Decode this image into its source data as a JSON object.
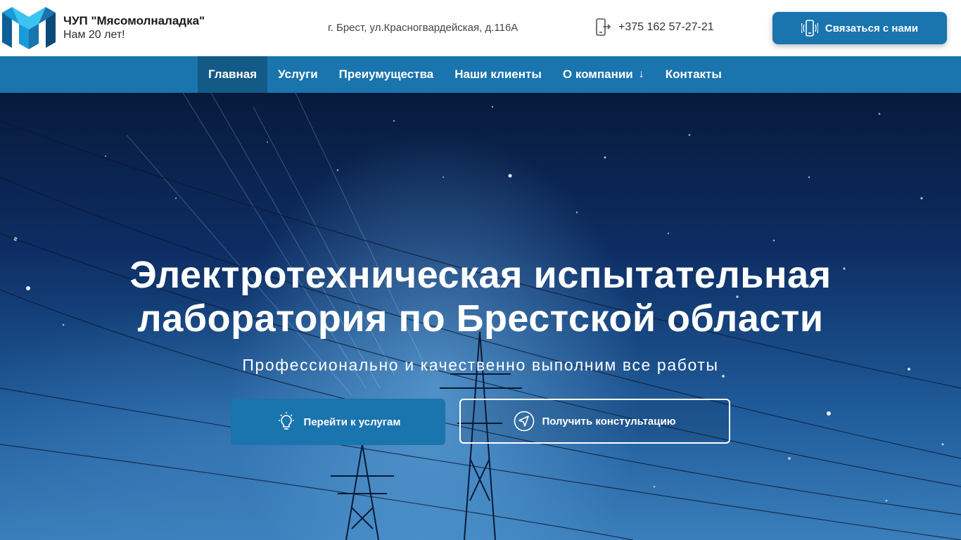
{
  "header": {
    "company_name": "ЧУП \"Мясомолналадка\"",
    "tagline": "Нам 20 лет!",
    "address": "г. Брест, ул.Красногвардейская, д.116А",
    "phone": "+375 162 57-27-21",
    "phone_icon": "phone-transfer-icon",
    "contact_button": "Связаться с нами",
    "contact_icon": "phone-vibrate-icon",
    "logo_icon": "company-logo-m"
  },
  "nav": {
    "items": [
      {
        "label": "Главная",
        "active": true
      },
      {
        "label": "Услуги",
        "active": false
      },
      {
        "label": "Преиумущества",
        "active": false
      },
      {
        "label": "Наши клиенты",
        "active": false
      },
      {
        "label": "О компании",
        "active": false,
        "arrow": "↓"
      },
      {
        "label": "Контакты",
        "active": false
      }
    ]
  },
  "hero": {
    "title_line1": "Электротехническая испытательная",
    "title_line2": "лаборатория по Брестской области",
    "subtitle": "Профессионально и качественно выполним все работы",
    "primary_button": "Перейти к услугам",
    "primary_icon": "lightbulb-icon",
    "secondary_button": "Получить констультацию",
    "secondary_icon": "send-arrow-icon"
  },
  "colors": {
    "primary": "#1a74ae",
    "nav_active": "#145a87",
    "header_bg": "#ffffff",
    "text_dark": "#1a1a1a"
  }
}
